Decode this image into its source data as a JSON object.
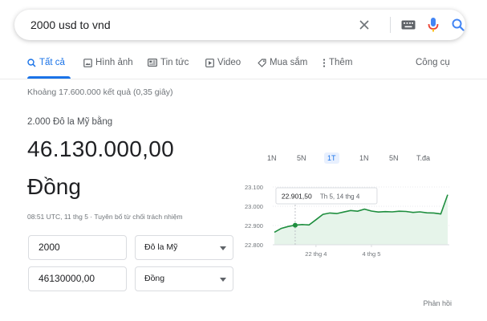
{
  "search": {
    "query": "2000 usd to vnd"
  },
  "icons": {
    "clear": "close-icon",
    "keyboard": "keyboard-icon",
    "mic": "mic-icon",
    "search": "search-icon"
  },
  "colors": {
    "accent": "#1a73e8",
    "chart_line": "#1e8e3e",
    "chart_fill": "#e6f4ea",
    "mic_red": "#ea4335",
    "mic_yellow": "#fbbc04"
  },
  "tabs": [
    {
      "label": "Tất cả",
      "icon": "search-icon",
      "active": true
    },
    {
      "label": "Hình ảnh",
      "icon": "image-icon",
      "active": false
    },
    {
      "label": "Tin tức",
      "icon": "news-icon",
      "active": false
    },
    {
      "label": "Video",
      "icon": "play-icon",
      "active": false
    },
    {
      "label": "Mua sắm",
      "icon": "tag-icon",
      "active": false
    },
    {
      "label": "Thêm",
      "icon": "more-vert-icon",
      "active": false
    }
  ],
  "tools_label": "Công cụ",
  "results_count": "Khoảng 17.600.000 kết quả (0,35 giây)",
  "converter": {
    "equals_label": "2.000 Đô la Mỹ bằng",
    "result_value": "46.130.000,00",
    "result_unit": "Đồng",
    "timestamp": "08:51 UTC, 11 thg 5 · Tuyên bố từ chối trách nhiệm",
    "from_amount": "2000",
    "from_unit": "Đô la Mỹ",
    "to_amount": "46130000,00",
    "to_unit": "Đồng"
  },
  "range_buttons": [
    {
      "label": "1N",
      "active": false
    },
    {
      "label": "5N",
      "active": false
    },
    {
      "label": "1T",
      "active": true
    },
    {
      "label": "1N",
      "active": false
    },
    {
      "label": "5N",
      "active": false
    },
    {
      "label": "T.đa",
      "active": false
    }
  ],
  "chart_data": {
    "type": "line",
    "ylim": [
      22800,
      23100
    ],
    "yticks": [
      "23.100",
      "23.000",
      "22.900",
      "22.800"
    ],
    "ytick_values": [
      23100,
      23000,
      22900,
      22800
    ],
    "xtick_labels": [
      "22 thg 4",
      "4 thg 5"
    ],
    "xtick_index": [
      6,
      14
    ],
    "values": [
      22865,
      22885,
      22895,
      22901.5,
      22905,
      22903,
      22930,
      22958,
      22965,
      22962,
      22970,
      22978,
      22974,
      22985,
      22975,
      22970,
      22972,
      22971,
      22974,
      22973,
      22968,
      22971,
      22966,
      22965,
      22960,
      23060
    ],
    "highlight_index": 3,
    "tooltip_value": "22.901,50",
    "tooltip_date": "Th 5, 14 thg 4"
  },
  "feedback_label": "Phản hồi"
}
